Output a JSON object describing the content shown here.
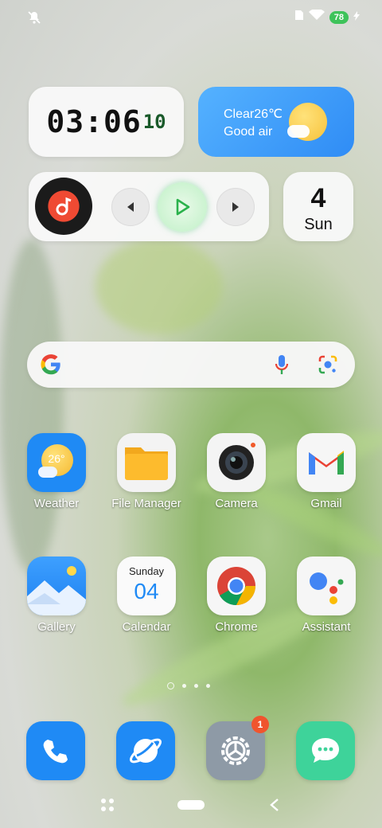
{
  "status": {
    "battery": "78"
  },
  "clock_widget": {
    "time": "03:06",
    "seconds": "10"
  },
  "weather_widget": {
    "line1": "Clear26℃",
    "line2": "Good air"
  },
  "date_widget": {
    "day_number": "4",
    "weekday": "Sun"
  },
  "apps": [
    {
      "label": "Weather",
      "icon_text": "26°"
    },
    {
      "label": "File Manager"
    },
    {
      "label": "Camera"
    },
    {
      "label": "Gmail"
    },
    {
      "label": "Gallery"
    },
    {
      "label": "Calendar",
      "icon_weekday": "Sunday",
      "icon_date": "04"
    },
    {
      "label": "Chrome"
    },
    {
      "label": "Assistant"
    }
  ],
  "dock": {
    "settings_badge": "1"
  },
  "colors": {
    "accent_blue": "#1f8af5",
    "settings_bg": "#8e9aa6",
    "messages_bg": "#3ed39a",
    "badge_red": "#f0552e"
  }
}
